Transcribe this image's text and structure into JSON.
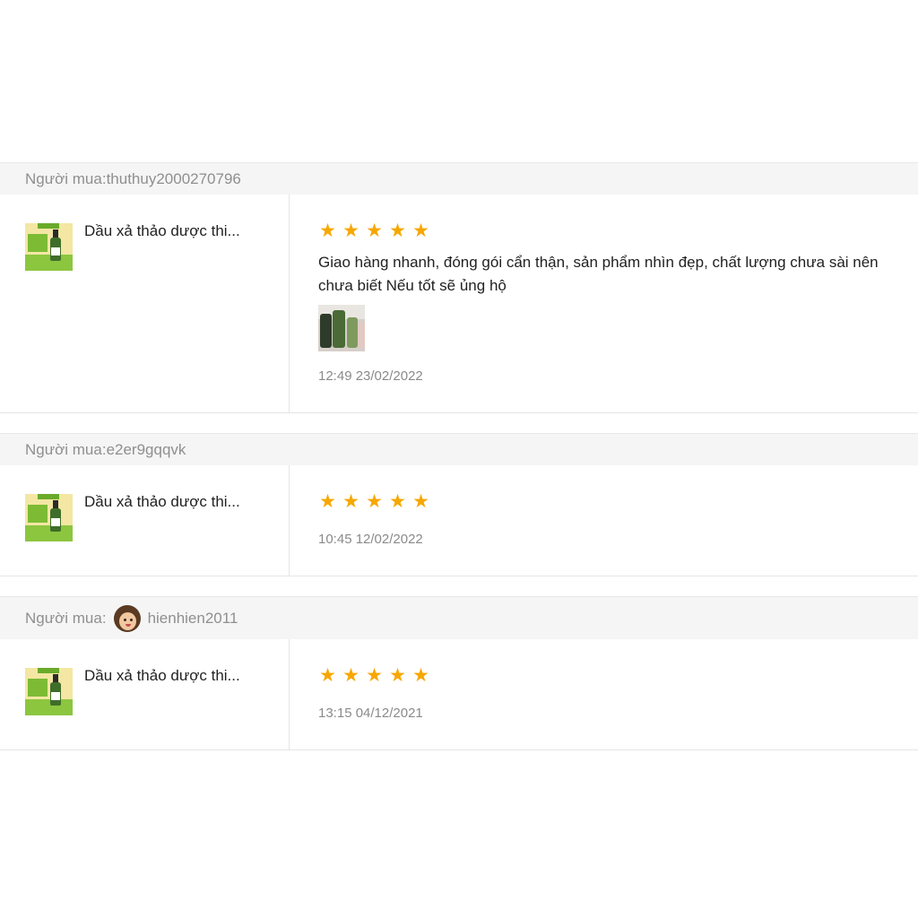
{
  "reviews": [
    {
      "buyer_prefix": "Người mua:",
      "buyer_name": "thuthuy2000270796",
      "product_name": "Dầu xả thảo dược thi...",
      "stars": [
        "★",
        "★",
        "★",
        "★",
        "★"
      ],
      "rating": 5,
      "comment": "Giao hàng nhanh, đóng gói cẩn thận, sản phẩm nhìn đẹp, chất lượng chưa sài nên chưa biết Nếu tốt sẽ ủng hộ",
      "timestamp": "12:49 23/02/2022"
    },
    {
      "buyer_prefix": "Người mua:",
      "buyer_name": "e2er9gqqvk",
      "product_name": "Dầu xả thảo dược thi...",
      "stars": [
        "★",
        "★",
        "★",
        "★",
        "★"
      ],
      "rating": 5,
      "timestamp": "10:45 12/02/2022"
    },
    {
      "buyer_prefix": "Người mua:",
      "buyer_name": "hienhien2011",
      "product_name": "Dầu xả thảo dược thi...",
      "stars": [
        "★",
        "★",
        "★",
        "★",
        "★"
      ],
      "rating": 5,
      "timestamp": "13:15 04/12/2021"
    }
  ],
  "colors": {
    "star": "#f6a700",
    "header_bg": "#f5f5f5",
    "muted_text": "#8f8f8f",
    "divider": "#e5e5e5"
  }
}
